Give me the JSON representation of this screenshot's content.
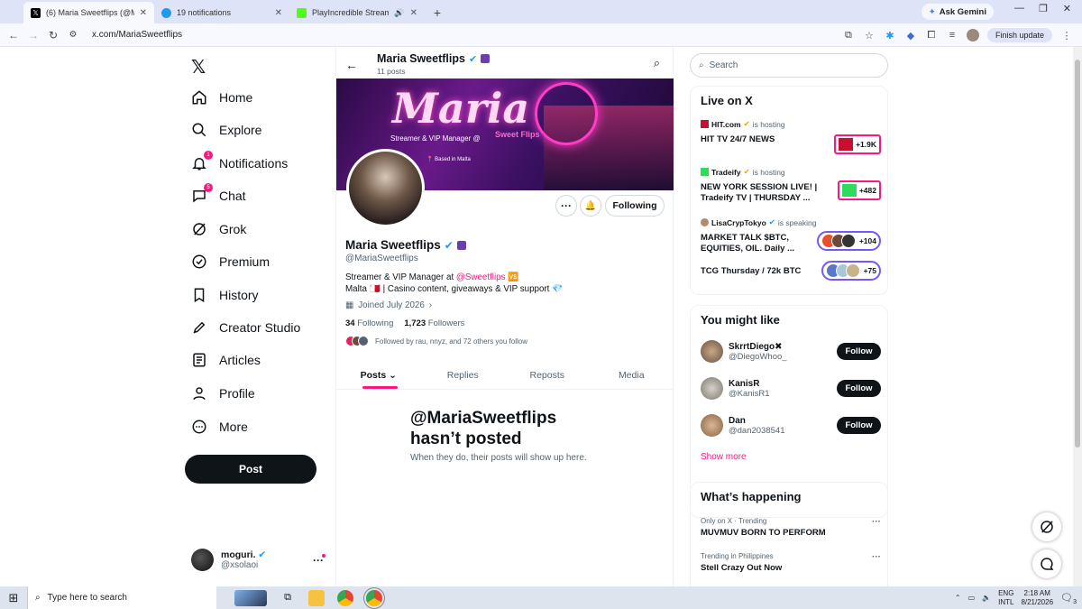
{
  "browser": {
    "tabs": [
      {
        "title": "(6) Maria Sweetflips (@MariaSw",
        "active": true,
        "favicon": "x-icon"
      },
      {
        "title": "19 notifications",
        "active": false,
        "favicon": "notif-icon"
      },
      {
        "title": "PlayIncredible Stream - Wa",
        "active": false,
        "favicon": "kick-icon"
      }
    ],
    "gemini_label": "Ask Gemini",
    "url": "x.com/MariaSweetflips",
    "finish_update": "Finish update"
  },
  "nav": {
    "logo": "𝕏",
    "items": [
      {
        "label": "Home",
        "icon": "home-icon"
      },
      {
        "label": "Explore",
        "icon": "search-icon"
      },
      {
        "label": "Notifications",
        "icon": "bell-icon",
        "badge": "1"
      },
      {
        "label": "Chat",
        "icon": "chat-icon",
        "badge": "5"
      },
      {
        "label": "Grok",
        "icon": "grok-icon"
      },
      {
        "label": "Premium",
        "icon": "premium-icon"
      },
      {
        "label": "History",
        "icon": "bookmark-icon"
      },
      {
        "label": "Creator Studio",
        "icon": "rocket-icon"
      },
      {
        "label": "Articles",
        "icon": "article-icon"
      },
      {
        "label": "Profile",
        "icon": "person-icon"
      },
      {
        "label": "More",
        "icon": "more-icon"
      }
    ],
    "post_label": "Post",
    "me": {
      "name": "moguri.",
      "handle": "@xsolaoi",
      "more": "···"
    }
  },
  "profile": {
    "header_name": "Maria Sweetflips",
    "post_count": "11 posts",
    "banner": {
      "title": "Maria",
      "subtitle": "Streamer & VIP Manager @",
      "brand": "Sweet Flips",
      "location": "Based in Malta"
    },
    "name": "Maria Sweetflips",
    "handle": "@MariaSweetflips",
    "bio_line1_prefix": "Streamer & VIP Manager at ",
    "bio_link": "@Sweetflips",
    "bio_line1_suffix": " 🆚",
    "bio_line2": "Malta 🇲🇹 | Casino content, giveaways & VIP support 💎",
    "joined": "Joined July 2026",
    "following_count": "34",
    "following_label": "Following",
    "followers_count": "1,723",
    "followers_label": "Followers",
    "followed_by": "Followed by rau, nnyz, and 72 others you follow",
    "following_button": "Following",
    "tabs": [
      "Posts",
      "Replies",
      "Reposts",
      "Media"
    ],
    "empty_title": "@MariaSweetflips hasn’t posted",
    "empty_sub": "When they do, their posts will show up here."
  },
  "search": {
    "placeholder": "Search"
  },
  "live": {
    "title": "Live on X",
    "items": [
      {
        "host": "HIT.com",
        "status": "is hosting",
        "title": "HIT TV 24/7 NEWS",
        "count": "+1.9K"
      },
      {
        "host": "Tradeify",
        "status": "is hosting",
        "title": "NEW YORK SESSION LIVE! | Tradeify TV | THURSDAY ...",
        "count": "+482"
      },
      {
        "host": "LisaCrypTokyo",
        "status": "is speaking",
        "title": "MARKET TALK $BTC, EQUITIES, OIL. Daily ...",
        "count": "+104"
      },
      {
        "host": "",
        "status": "",
        "title": "TCG Thursday / 72k BTC",
        "count": "+75"
      }
    ]
  },
  "suggestions": {
    "title": "You might like",
    "items": [
      {
        "name": "SkrrtDiego✖",
        "handle": "@DiegoWhoo_",
        "button": "Follow"
      },
      {
        "name": "KanisR",
        "handle": "@KanisR1",
        "button": "Follow"
      },
      {
        "name": "Dan",
        "handle": "@dan2038541",
        "button": "Follow"
      }
    ],
    "show_more": "Show more"
  },
  "happening": {
    "title": "What’s happening",
    "items": [
      {
        "context": "Only on X · Trending",
        "title": "MUVMUV BORN TO PERFORM"
      },
      {
        "context": "Trending in Philippines",
        "title": "Stell Crazy Out Now"
      }
    ]
  },
  "taskbar": {
    "search_placeholder": "Type here to search",
    "lang": "ENG",
    "lang2": "INTL",
    "time": "2:18 AM",
    "date": "8/21/2026",
    "notif_count": "3"
  },
  "colors": {
    "accent": "#f91880",
    "verified": "#1d9bf0",
    "text": "#0f1419",
    "muted": "#536471"
  }
}
